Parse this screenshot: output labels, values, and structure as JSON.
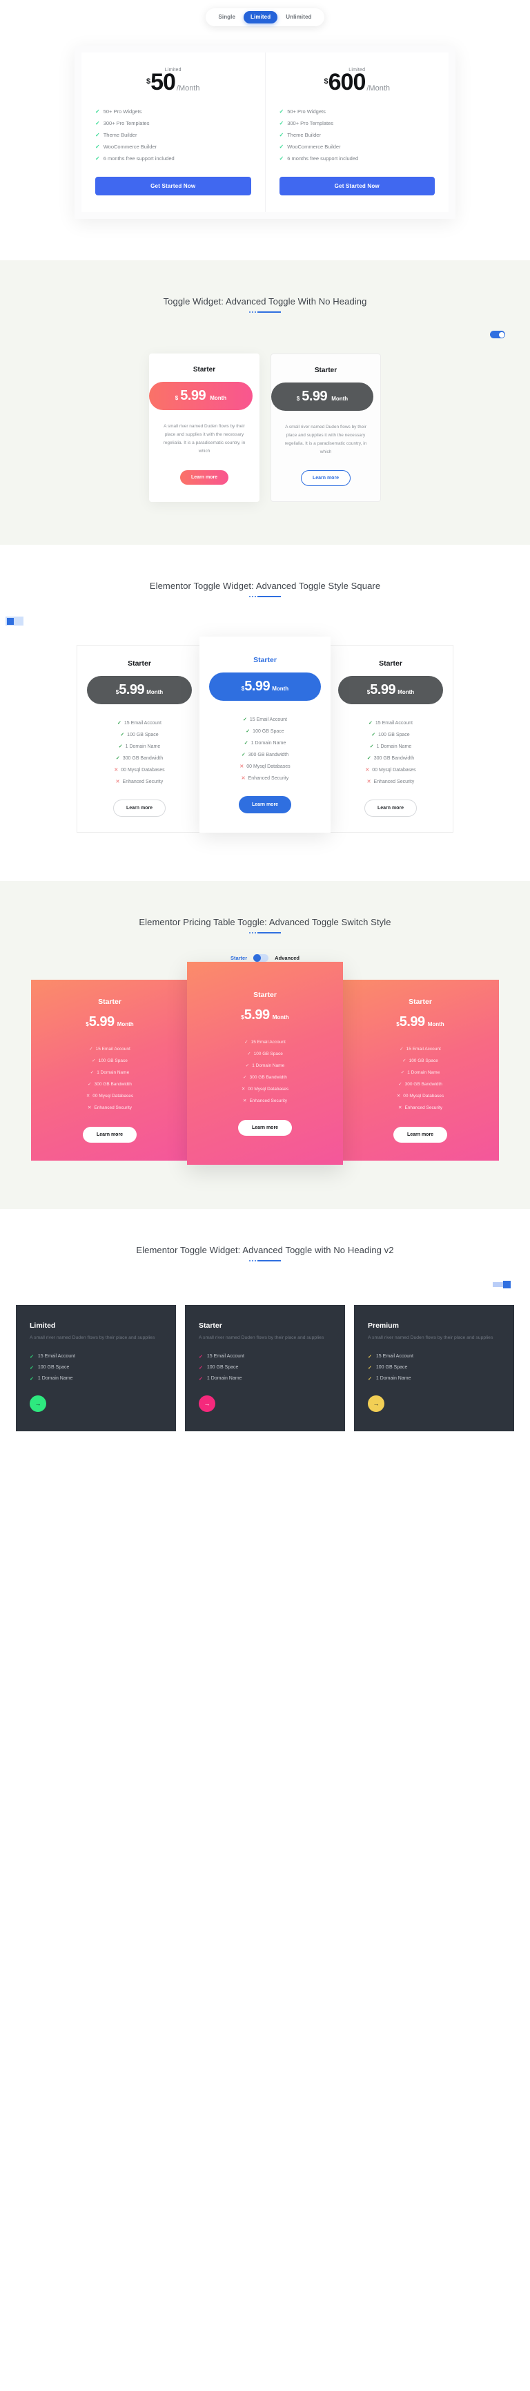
{
  "section1": {
    "toggle": {
      "options": [
        "Single",
        "Limited",
        "Unlimited"
      ],
      "active_index": 1,
      "active_color": "#2563d9"
    },
    "cards": [
      {
        "label": "Limited",
        "currency": "$",
        "amount": "50",
        "period": "/Month",
        "features": [
          "50+ Pro Widgets",
          "300+ Pro Templates",
          "Theme Builder",
          "WooCommerce Builder",
          "6 months free support included"
        ],
        "cta": "Get Started Now"
      },
      {
        "label": "Limited",
        "currency": "$",
        "amount": "600",
        "period": "/Month",
        "features": [
          "50+ Pro Widgets",
          "300+ Pro Templates",
          "Theme Builder",
          "WooCommerce Builder",
          "6 months free support included"
        ],
        "cta": "Get Started Now"
      }
    ]
  },
  "section2": {
    "title": "Toggle Widget: Advanced Toggle With No Heading",
    "switch_on": true,
    "cards": [
      {
        "title": "Starter",
        "currency": "$",
        "amount": "5.99",
        "period": "Month",
        "desc": "A small river named Duden flows by their place and supplies it with the necessary regelialia. It is a paradisematic country, in which",
        "button": "Learn more"
      },
      {
        "title": "Starter",
        "currency": "$",
        "amount": "5.99",
        "period": "Month",
        "desc": "A small river named Duden flows by their place and supplies it with the necessary regelialia. It is a paradisematic country, in which",
        "button": "Learn more"
      }
    ]
  },
  "section3": {
    "title": "Elementor Toggle Widget: Advanced Toggle Style Square",
    "cards": [
      {
        "title": "Starter",
        "currency": "$",
        "amount": "5.99",
        "period": "Month",
        "button": "Learn more",
        "features": [
          {
            "label": "15 Email Account",
            "ok": true
          },
          {
            "label": "100 GB Space",
            "ok": true
          },
          {
            "label": "1 Domain Name",
            "ok": true
          },
          {
            "label": "300 GB Bandwidth",
            "ok": true
          },
          {
            "label": "00 Mysql Databases",
            "ok": false
          },
          {
            "label": "Enhanced Security",
            "ok": false
          }
        ]
      },
      {
        "title": "Starter",
        "currency": "$",
        "amount": "5.99",
        "period": "Month",
        "button": "Learn more",
        "features": [
          {
            "label": "15 Email Account",
            "ok": true
          },
          {
            "label": "100 GB Space",
            "ok": true
          },
          {
            "label": "1 Domain Name",
            "ok": true
          },
          {
            "label": "300 GB Bandwidth",
            "ok": true
          },
          {
            "label": "00 Mysql Databases",
            "ok": false
          },
          {
            "label": "Enhanced Security",
            "ok": false
          }
        ]
      },
      {
        "title": "Starter",
        "currency": "$",
        "amount": "5.99",
        "period": "Month",
        "button": "Learn more",
        "features": [
          {
            "label": "15 Email Account",
            "ok": true
          },
          {
            "label": "100 GB Space",
            "ok": true
          },
          {
            "label": "1 Domain Name",
            "ok": true
          },
          {
            "label": "300 GB Bandwidth",
            "ok": true
          },
          {
            "label": "00 Mysql Databases",
            "ok": false
          },
          {
            "label": "Enhanced Security",
            "ok": false
          }
        ]
      }
    ]
  },
  "section4": {
    "title": "Elementor Pricing Table Toggle: Advanced Toggle Switch Style",
    "switch_left_label": "Starter",
    "switch_right_label": "Advanced",
    "cards": [
      {
        "title": "Starter",
        "currency": "$",
        "amount": "5.99",
        "period": "Month",
        "button": "Learn more",
        "features": [
          {
            "label": "15 Email Account",
            "ok": true
          },
          {
            "label": "100 GB Space",
            "ok": true
          },
          {
            "label": "1 Domain Name",
            "ok": true
          },
          {
            "label": "300 GB Bandwidth",
            "ok": true
          },
          {
            "label": "00 Mysql Databases",
            "ok": false
          },
          {
            "label": "Enhanced Security",
            "ok": false
          }
        ]
      },
      {
        "title": "Starter",
        "currency": "$",
        "amount": "5.99",
        "period": "Month",
        "button": "Learn more",
        "features": [
          {
            "label": "15 Email Account",
            "ok": true
          },
          {
            "label": "100 GB Space",
            "ok": true
          },
          {
            "label": "1 Domain Name",
            "ok": true
          },
          {
            "label": "300 GB Bandwidth",
            "ok": true
          },
          {
            "label": "00 Mysql Databases",
            "ok": false
          },
          {
            "label": "Enhanced Security",
            "ok": false
          }
        ]
      },
      {
        "title": "Starter",
        "currency": "$",
        "amount": "5.99",
        "period": "Month",
        "button": "Learn more",
        "features": [
          {
            "label": "15 Email Account",
            "ok": true
          },
          {
            "label": "100 GB Space",
            "ok": true
          },
          {
            "label": "1 Domain Name",
            "ok": true
          },
          {
            "label": "300 GB Bandwidth",
            "ok": true
          },
          {
            "label": "00 Mysql Databases",
            "ok": false
          },
          {
            "label": "Enhanced Security",
            "ok": false
          }
        ]
      }
    ]
  },
  "section5": {
    "title": "Elementor Toggle Widget: Advanced Toggle with No Heading v2",
    "cards": [
      {
        "title": "Limited",
        "desc": "A small river named Duden flows by their place and supplies",
        "accent": "#2ee87f",
        "features": [
          "15 Email Account",
          "100 GB Space",
          "1 Domain Name"
        ],
        "arrow": "→"
      },
      {
        "title": "Starter",
        "desc": "A small river named Duden flows by their place and supplies",
        "accent": "#f5297c",
        "features": [
          "15 Email Account",
          "100 GB Space",
          "1 Domain Name"
        ],
        "arrow": "→"
      },
      {
        "title": "Premium",
        "desc": "A small river named Duden flows by their place and supplies",
        "accent": "#f2cf55",
        "features": [
          "15 Email Account",
          "100 GB Space",
          "1 Domain Name"
        ],
        "arrow": "→"
      }
    ]
  }
}
